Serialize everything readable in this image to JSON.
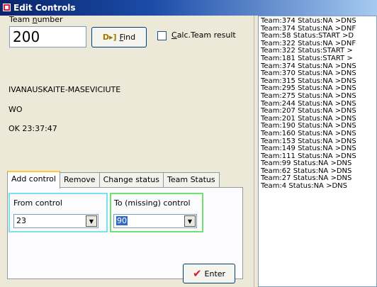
{
  "window": {
    "title": "Edit Controls"
  },
  "team": {
    "number_label_prefix": "Team ",
    "number_label_accel": "n",
    "number_label_suffix": "umber",
    "number_value": "200",
    "find_label_accel": "F",
    "find_label_rest": "ind",
    "calc_label_accel": "C",
    "calc_label_rest": "alc.Team result",
    "calc_checked": false,
    "name": "IVANAUSKAITE-MASEVICIUTE",
    "class": "WO",
    "status_time": "OK 23:37:47"
  },
  "tabs": [
    "Add control",
    "Remove",
    "Change status",
    "Team Status"
  ],
  "active_tab": "Add control",
  "add_control": {
    "from_label": "From control",
    "from_value": "23",
    "to_label": "To (missing) control",
    "to_value": "90",
    "enter_label": "Enter"
  },
  "log": [
    "Team:374 Status:NA >DNS",
    "Team:374 Status:NA >DNF",
    "Team:58 Status:START >D",
    "Team:322 Status:NA >DNF",
    "Team:322 Status:START >",
    "Team:181 Status:START >",
    "Team:374 Status:NA >DNS",
    "Team:370 Status:NA >DNS",
    "Team:315 Status:NA >DNS",
    "Team:295 Status:NA >DNS",
    "Team:275 Status:NA >DNS",
    "Team:244 Status:NA >DNS",
    "Team:207 Status:NA >DNS",
    "Team:201 Status:NA >DNS",
    "Team:190 Status:NA >DNS",
    "Team:160 Status:NA >DNS",
    "Team:153 Status:NA >DNS",
    "Team:149 Status:NA >DNS",
    "Team:111 Status:NA >DNS",
    "Team:99 Status:NA >DNS",
    "Team:62 Status:NA >DNS",
    "Team:27 Status:NA >DNS",
    "Team:4 Status:NA >DNS"
  ]
}
